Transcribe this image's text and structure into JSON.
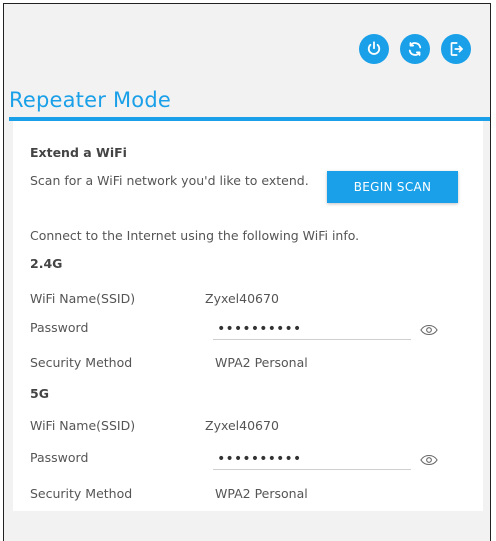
{
  "header": {
    "power_label": "power-icon",
    "refresh_label": "refresh-icon",
    "logout_label": "logout-icon"
  },
  "page": {
    "title": "Repeater Mode"
  },
  "extend": {
    "heading": "Extend a WiFi",
    "description": "Scan for a WiFi network you'd like to extend.",
    "scan_button": "BEGIN SCAN",
    "connect_info": "Connect to the Internet using the following WiFi info."
  },
  "band24": {
    "heading": "2.4G",
    "ssid_label": "WiFi Name(SSID)",
    "ssid_value": "Zyxel40670",
    "password_label": "Password",
    "password_value": "••••••••••",
    "security_label": "Security Method",
    "security_value": "WPA2 Personal"
  },
  "band5": {
    "heading": "5G",
    "ssid_label": "WiFi Name(SSID)",
    "ssid_value": "Zyxel40670",
    "password_label": "Password",
    "password_value": "••••••••••",
    "security_label": "Security Method",
    "security_value": "WPA2 Personal"
  },
  "colors": {
    "accent": "#1aa0e8",
    "panel": "#ffffff",
    "background": "#f2f2f2"
  }
}
